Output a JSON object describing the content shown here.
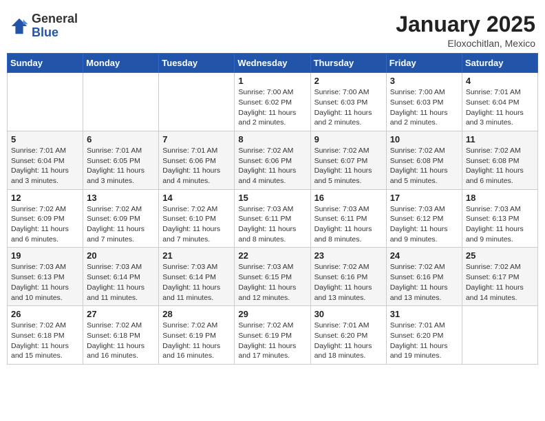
{
  "header": {
    "logo_general": "General",
    "logo_blue": "Blue",
    "month_title": "January 2025",
    "location": "Eloxochitlan, Mexico"
  },
  "days_of_week": [
    "Sunday",
    "Monday",
    "Tuesday",
    "Wednesday",
    "Thursday",
    "Friday",
    "Saturday"
  ],
  "weeks": [
    [
      {
        "num": "",
        "info": ""
      },
      {
        "num": "",
        "info": ""
      },
      {
        "num": "",
        "info": ""
      },
      {
        "num": "1",
        "info": "Sunrise: 7:00 AM\nSunset: 6:02 PM\nDaylight: 11 hours\nand 2 minutes."
      },
      {
        "num": "2",
        "info": "Sunrise: 7:00 AM\nSunset: 6:03 PM\nDaylight: 11 hours\nand 2 minutes."
      },
      {
        "num": "3",
        "info": "Sunrise: 7:00 AM\nSunset: 6:03 PM\nDaylight: 11 hours\nand 2 minutes."
      },
      {
        "num": "4",
        "info": "Sunrise: 7:01 AM\nSunset: 6:04 PM\nDaylight: 11 hours\nand 3 minutes."
      }
    ],
    [
      {
        "num": "5",
        "info": "Sunrise: 7:01 AM\nSunset: 6:04 PM\nDaylight: 11 hours\nand 3 minutes."
      },
      {
        "num": "6",
        "info": "Sunrise: 7:01 AM\nSunset: 6:05 PM\nDaylight: 11 hours\nand 3 minutes."
      },
      {
        "num": "7",
        "info": "Sunrise: 7:01 AM\nSunset: 6:06 PM\nDaylight: 11 hours\nand 4 minutes."
      },
      {
        "num": "8",
        "info": "Sunrise: 7:02 AM\nSunset: 6:06 PM\nDaylight: 11 hours\nand 4 minutes."
      },
      {
        "num": "9",
        "info": "Sunrise: 7:02 AM\nSunset: 6:07 PM\nDaylight: 11 hours\nand 5 minutes."
      },
      {
        "num": "10",
        "info": "Sunrise: 7:02 AM\nSunset: 6:08 PM\nDaylight: 11 hours\nand 5 minutes."
      },
      {
        "num": "11",
        "info": "Sunrise: 7:02 AM\nSunset: 6:08 PM\nDaylight: 11 hours\nand 6 minutes."
      }
    ],
    [
      {
        "num": "12",
        "info": "Sunrise: 7:02 AM\nSunset: 6:09 PM\nDaylight: 11 hours\nand 6 minutes."
      },
      {
        "num": "13",
        "info": "Sunrise: 7:02 AM\nSunset: 6:09 PM\nDaylight: 11 hours\nand 7 minutes."
      },
      {
        "num": "14",
        "info": "Sunrise: 7:02 AM\nSunset: 6:10 PM\nDaylight: 11 hours\nand 7 minutes."
      },
      {
        "num": "15",
        "info": "Sunrise: 7:03 AM\nSunset: 6:11 PM\nDaylight: 11 hours\nand 8 minutes."
      },
      {
        "num": "16",
        "info": "Sunrise: 7:03 AM\nSunset: 6:11 PM\nDaylight: 11 hours\nand 8 minutes."
      },
      {
        "num": "17",
        "info": "Sunrise: 7:03 AM\nSunset: 6:12 PM\nDaylight: 11 hours\nand 9 minutes."
      },
      {
        "num": "18",
        "info": "Sunrise: 7:03 AM\nSunset: 6:13 PM\nDaylight: 11 hours\nand 9 minutes."
      }
    ],
    [
      {
        "num": "19",
        "info": "Sunrise: 7:03 AM\nSunset: 6:13 PM\nDaylight: 11 hours\nand 10 minutes."
      },
      {
        "num": "20",
        "info": "Sunrise: 7:03 AM\nSunset: 6:14 PM\nDaylight: 11 hours\nand 11 minutes."
      },
      {
        "num": "21",
        "info": "Sunrise: 7:03 AM\nSunset: 6:14 PM\nDaylight: 11 hours\nand 11 minutes."
      },
      {
        "num": "22",
        "info": "Sunrise: 7:03 AM\nSunset: 6:15 PM\nDaylight: 11 hours\nand 12 minutes."
      },
      {
        "num": "23",
        "info": "Sunrise: 7:02 AM\nSunset: 6:16 PM\nDaylight: 11 hours\nand 13 minutes."
      },
      {
        "num": "24",
        "info": "Sunrise: 7:02 AM\nSunset: 6:16 PM\nDaylight: 11 hours\nand 13 minutes."
      },
      {
        "num": "25",
        "info": "Sunrise: 7:02 AM\nSunset: 6:17 PM\nDaylight: 11 hours\nand 14 minutes."
      }
    ],
    [
      {
        "num": "26",
        "info": "Sunrise: 7:02 AM\nSunset: 6:18 PM\nDaylight: 11 hours\nand 15 minutes."
      },
      {
        "num": "27",
        "info": "Sunrise: 7:02 AM\nSunset: 6:18 PM\nDaylight: 11 hours\nand 16 minutes."
      },
      {
        "num": "28",
        "info": "Sunrise: 7:02 AM\nSunset: 6:19 PM\nDaylight: 11 hours\nand 16 minutes."
      },
      {
        "num": "29",
        "info": "Sunrise: 7:02 AM\nSunset: 6:19 PM\nDaylight: 11 hours\nand 17 minutes."
      },
      {
        "num": "30",
        "info": "Sunrise: 7:01 AM\nSunset: 6:20 PM\nDaylight: 11 hours\nand 18 minutes."
      },
      {
        "num": "31",
        "info": "Sunrise: 7:01 AM\nSunset: 6:20 PM\nDaylight: 11 hours\nand 19 minutes."
      },
      {
        "num": "",
        "info": ""
      }
    ]
  ]
}
